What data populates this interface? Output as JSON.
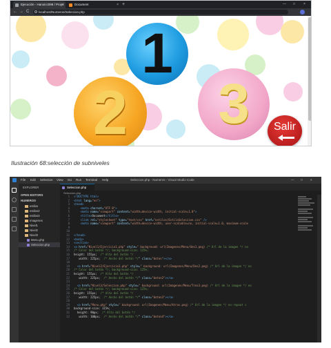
{
  "browser": {
    "tabs": [
      {
        "title": "Ejecución - Hanoicc098 / Proye",
        "close": "×"
      },
      {
        "title": "Document",
        "close": "×"
      }
    ],
    "new_tab": "+",
    "window_controls": [
      "—",
      "□",
      "×"
    ],
    "nav": {
      "back": "←",
      "forward": "→",
      "reload": "C"
    },
    "url": "localhost/Numeros/Seleccion.php",
    "page": {
      "numbers": [
        "1",
        "2",
        "3"
      ],
      "exit_label": "Salir"
    },
    "colors": {
      "ball_1": "#1e9be0",
      "ball_2": "#f6a623",
      "ball_3": "#f2a7c9",
      "exit": "#d32f2f"
    }
  },
  "caption": "Ilustración 68:selección de subniveles",
  "vscode": {
    "menu": [
      "File",
      "Edit",
      "Selection",
      "View",
      "Go",
      "Run",
      "Terminal",
      "Help"
    ],
    "window_title": "Seleccion.php - Numeros - Visual Studio Code",
    "sidebar": {
      "header": "EXPLORER",
      "open_editors": "OPEN EDITORS",
      "project": "NUMEROS",
      "items": [
        {
          "label": "estilos",
          "type": "folder"
        },
        {
          "label": "estilos2",
          "type": "folder"
        },
        {
          "label": "estilos3",
          "type": "folder"
        },
        {
          "label": "Imagenes",
          "type": "folder"
        },
        {
          "label": "Nivel1",
          "type": "folder"
        },
        {
          "label": "Nivel2",
          "type": "folder"
        },
        {
          "label": "Nivel3",
          "type": "folder"
        },
        {
          "label": "Menu.php",
          "type": "file"
        },
        {
          "label": "Seleccion.php",
          "type": "file",
          "active": true
        }
      ]
    },
    "active_tab": "Seleccion.php",
    "breadcrumb": "Seleccion.php",
    "code": [
      {
        "n": "1",
        "segs": [
          {
            "t": "<!DOCTYPE html>",
            "c": "c-tag"
          }
        ]
      },
      {
        "n": "2",
        "segs": [
          {
            "t": "<html ",
            "c": "c-tag"
          },
          {
            "t": "lang=",
            "c": "c-attr"
          },
          {
            "t": "\"en\"",
            "c": "c-str"
          },
          {
            "t": ">",
            "c": "c-tag"
          }
        ]
      },
      {
        "n": "3",
        "segs": [
          {
            "t": "<head>",
            "c": "c-tag"
          }
        ]
      },
      {
        "n": "4",
        "segs": [
          {
            "t": "    <meta ",
            "c": "c-tag"
          },
          {
            "t": "charset=",
            "c": "c-attr"
          },
          {
            "t": "\"UTF-8\"",
            "c": "c-str"
          },
          {
            "t": ">",
            "c": "c-tag"
          }
        ]
      },
      {
        "n": "5",
        "segs": [
          {
            "t": "    <meta ",
            "c": "c-tag"
          },
          {
            "t": "name=",
            "c": "c-attr"
          },
          {
            "t": "\"viewport\" ",
            "c": "c-str"
          },
          {
            "t": "content=",
            "c": "c-attr"
          },
          {
            "t": "\"width=device-width, initial-scale=1.0\"",
            "c": "c-str"
          },
          {
            "t": ">",
            "c": "c-tag"
          }
        ]
      },
      {
        "n": "6",
        "segs": [
          {
            "t": "    <title>",
            "c": "c-tag"
          },
          {
            "t": "Document",
            "c": "c-txt"
          },
          {
            "t": "</title>",
            "c": "c-tag"
          }
        ]
      },
      {
        "n": "7",
        "segs": [
          {
            "t": "    <link ",
            "c": "c-tag"
          },
          {
            "t": "rel=",
            "c": "c-attr"
          },
          {
            "t": "\"stylesheet\" ",
            "c": "c-str"
          },
          {
            "t": "type=",
            "c": "c-attr"
          },
          {
            "t": "\"text/css\" ",
            "c": "c-str"
          },
          {
            "t": "href=",
            "c": "c-attr"
          },
          {
            "t": "\"estilos/EstiloSeleccion.css\"",
            "c": "c-str"
          },
          {
            "t": " />",
            "c": "c-tag"
          }
        ]
      },
      {
        "n": "8",
        "segs": [
          {
            "t": "    <meta ",
            "c": "c-tag"
          },
          {
            "t": "name=",
            "c": "c-attr"
          },
          {
            "t": "\"viewport\" ",
            "c": "c-str"
          },
          {
            "t": "content=",
            "c": "c-attr"
          },
          {
            "t": "\"width=device-width, user-scalable=no, initial-scale=1.0, maximum-scale",
            "c": "c-str"
          }
        ]
      },
      {
        "n": "9",
        "segs": []
      },
      {
        "n": "10",
        "segs": []
      },
      {
        "n": "11",
        "segs": [
          {
            "t": "</head>",
            "c": "c-tag"
          }
        ]
      },
      {
        "n": "12",
        "segs": [
          {
            "t": "<body>",
            "c": "c-tag"
          }
        ]
      },
      {
        "n": "13",
        "segs": [
          {
            "t": "<section>",
            "c": "c-tag"
          }
        ]
      },
      {
        "n": "14",
        "segs": [
          {
            "t": "<a ",
            "c": "c-tag"
          },
          {
            "t": "href=",
            "c": "c-attr"
          },
          {
            "t": "\"Nivel1/Ejercicio1.php\" ",
            "c": "c-str"
          },
          {
            "t": "style=",
            "c": "c-attr"
          },
          {
            "t": "\" background: url(Imagenes/Menu/Uno1.png) ",
            "c": "c-str"
          },
          {
            "t": "/* Url de la imagen */ no",
            "c": "c-com"
          }
        ]
      },
      {
        "n": "15",
        "segs": [
          {
            "t": "/* Color del botón */; background-size: 125%;",
            "c": "c-com"
          }
        ]
      },
      {
        "n": "16",
        "segs": [
          {
            "t": "height: 155px;  ",
            "c": "c-txt"
          },
          {
            "t": "/* Alto del botón */",
            "c": "c-com"
          }
        ]
      },
      {
        "n": "17",
        "segs": [
          {
            "t": "   width: 225px;  ",
            "c": "c-txt"
          },
          {
            "t": "/* Ancho del botón */",
            "c": "c-com"
          },
          {
            "t": "\" class=",
            "c": "c-attr"
          },
          {
            "t": "\"boton\"",
            "c": "c-str"
          },
          {
            "t": "></a>",
            "c": "c-tag"
          }
        ]
      },
      {
        "n": "18",
        "segs": []
      },
      {
        "n": "19",
        "segs": [
          {
            "t": "  <a ",
            "c": "c-tag"
          },
          {
            "t": "href=",
            "c": "c-attr"
          },
          {
            "t": "\"Nivel2/Ejercicio1.php\" ",
            "c": "c-str"
          },
          {
            "t": "style=",
            "c": "c-attr"
          },
          {
            "t": "\" background: url(Imagenes/Menu/Dos2.png) ",
            "c": "c-str"
          },
          {
            "t": "/* Url de la imagen */ no",
            "c": "c-com"
          }
        ]
      },
      {
        "n": "20",
        "segs": [
          {
            "t": "/* Color del botón */; background-size: 125%;",
            "c": "c-com"
          }
        ]
      },
      {
        "n": "21",
        "segs": [
          {
            "t": "height: 155px;  ",
            "c": "c-txt"
          },
          {
            "t": "/* Alto del botón */",
            "c": "c-com"
          }
        ]
      },
      {
        "n": "22",
        "segs": [
          {
            "t": "   width: 225px;  ",
            "c": "c-txt"
          },
          {
            "t": "/* Ancho del botón */",
            "c": "c-com"
          },
          {
            "t": "\" class=",
            "c": "c-attr"
          },
          {
            "t": "\"boton2\"",
            "c": "c-str"
          },
          {
            "t": "></a>",
            "c": "c-tag"
          }
        ]
      },
      {
        "n": "23",
        "segs": []
      },
      {
        "n": "24",
        "segs": [
          {
            "t": "  <a ",
            "c": "c-tag"
          },
          {
            "t": "href=",
            "c": "c-attr"
          },
          {
            "t": "\"Nivel3/Seleccion.php\" ",
            "c": "c-str"
          },
          {
            "t": "style=",
            "c": "c-attr"
          },
          {
            "t": "\" background: url(Imagenes/Menu/Tres3.png) ",
            "c": "c-str"
          },
          {
            "t": "/* Url de la imagen */ no",
            "c": "c-com"
          }
        ]
      },
      {
        "n": "25",
        "segs": [
          {
            "t": "/* Color del botón */; background-size: 125%;",
            "c": "c-com"
          }
        ]
      },
      {
        "n": "26",
        "segs": [
          {
            "t": "height: 155px;  ",
            "c": "c-txt"
          },
          {
            "t": "/* Alto del botón */",
            "c": "c-com"
          }
        ]
      },
      {
        "n": "27",
        "segs": [
          {
            "t": "   width: 225px;  ",
            "c": "c-txt"
          },
          {
            "t": "/* Ancho del botón */",
            "c": "c-com"
          },
          {
            "t": "\" class=",
            "c": "c-attr"
          },
          {
            "t": "\"boton3\"",
            "c": "c-str"
          },
          {
            "t": "></a>",
            "c": "c-tag"
          }
        ]
      },
      {
        "n": "28",
        "segs": []
      },
      {
        "n": "29",
        "segs": [
          {
            "t": "  <a ",
            "c": "c-tag"
          },
          {
            "t": "href=",
            "c": "c-attr"
          },
          {
            "t": "\"Menu.php\" ",
            "c": "c-str"
          },
          {
            "t": "style=",
            "c": "c-attr"
          },
          {
            "t": "\" background: url(Imagenes/Menu/Atras.png) ",
            "c": "c-str"
          },
          {
            "t": "/* Url de la imagen */ no-repeat c",
            "c": "c-com"
          }
        ]
      },
      {
        "n": "30",
        "segs": [
          {
            "t": "background-size: 115%;",
            "c": "c-txt"
          }
        ]
      },
      {
        "n": "31",
        "segs": [
          {
            "t": "  height: 90px;  ",
            "c": "c-txt"
          },
          {
            "t": "/* Alto del botón */",
            "c": "c-com"
          }
        ]
      },
      {
        "n": "32",
        "segs": [
          {
            "t": "   width: 100px;  ",
            "c": "c-txt"
          },
          {
            "t": "/* Ancho del botón */",
            "c": "c-com"
          },
          {
            "t": "\" class=",
            "c": "c-attr"
          },
          {
            "t": "\"boton4\"",
            "c": "c-str"
          },
          {
            "t": "></a>",
            "c": "c-tag"
          }
        ]
      }
    ]
  }
}
